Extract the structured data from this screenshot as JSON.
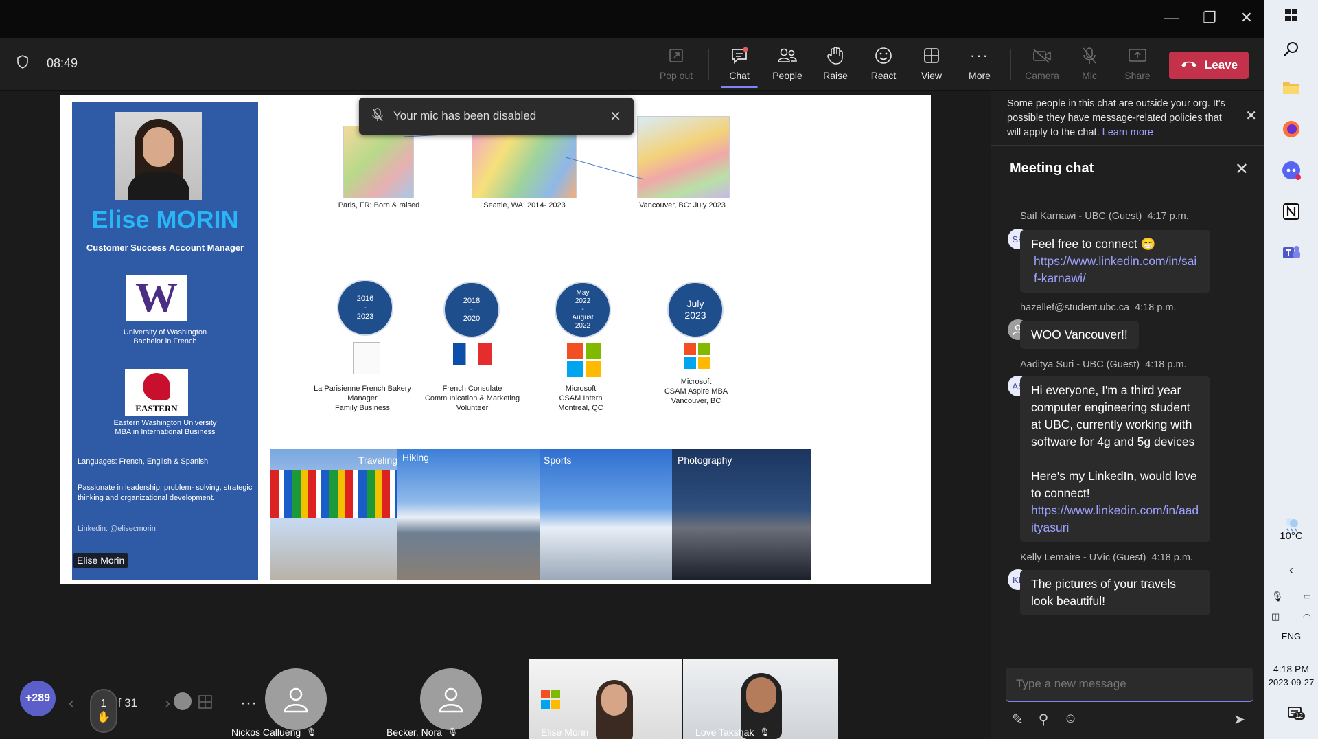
{
  "toolbar": {
    "time": "08:49",
    "pop_out": "Pop out",
    "chat": "Chat",
    "people": "People",
    "raise": "Raise",
    "react": "React",
    "view": "View",
    "more": "More",
    "camera": "Camera",
    "mic": "Mic",
    "share": "Share",
    "leave": "Leave"
  },
  "toast": {
    "text": "Your mic has been disabled"
  },
  "slide": {
    "name": "Elise  MORIN",
    "role": "Customer Success Account Manager",
    "uw_line1": "University of Washington",
    "uw_line2": "Bachelor in French",
    "ew_logo_text": "EASTERN",
    "ew_line1": "Eastern Washington University",
    "ew_line2": "MBA in International Business",
    "languages": "Languages: French, English & Spanish",
    "passion": "Passionate in leadership, problem- solving, strategic thinking and organizational development.",
    "linkedin": "Linkedin: @elisecmorin",
    "map1": "Paris, FR: Born & raised",
    "map2": "Seattle, WA: 2014- 2023",
    "map3": "Vancouver, BC: July 2023",
    "t1_a": "2016",
    "t1_b": "-",
    "t1_c": "2023",
    "t2_a": "2018",
    "t2_b": "-",
    "t2_c": "2020",
    "t3_a": "May",
    "t3_b": "2022",
    "t3_c": "-",
    "t3_d": "August",
    "t3_e": "2022",
    "t4_a": "July",
    "t4_b": "2023",
    "l1_a": "La Parisienne French Bakery",
    "l1_b": "Manager",
    "l1_c": "Family Business",
    "l2_a": "French Consulate",
    "l2_b": "Communication & Marketing",
    "l2_c": "Volunteer",
    "l3_a": "Microsoft",
    "l3_b": "CSAM Intern",
    "l3_c": "Montreal, QC",
    "l4_a": "Microsoft",
    "l4_b": "CSAM Aspire MBA",
    "l4_c": "Vancouver, BC",
    "h1": "Traveling",
    "h2": "Hiking",
    "h3": "Sports",
    "h4": "Photography",
    "presenter": "Elise Morin"
  },
  "slide_nav": {
    "position": "9 of 31"
  },
  "participants": {
    "count": "+289",
    "raised": "1",
    "p1": "Nickos Callueng",
    "p2": "Becker, Nora",
    "p3": "Elise Morin",
    "p4": "Love Takshak"
  },
  "chat": {
    "banner": "Some people in this chat are outside your org. It's possible they have message-related policies that will apply to the chat.",
    "banner_link": "Learn more",
    "title": "Meeting chat",
    "m1_author": "Saif Karnawi - UBC (Guest)",
    "m1_time": "4:17 p.m.",
    "m1_initials": "SK",
    "m1_text": "Feel free to connect 😁",
    "m1_link": "https://www.linkedin.com/in/saif-karnawi/",
    "m2_author": "hazellef@student.ubc.ca",
    "m2_time": "4:18 p.m.",
    "m2_text": "WOO Vancouver!!",
    "m3_author": "Aaditya Suri - UBC (Guest)",
    "m3_time": "4:18 p.m.",
    "m3_initials": "AS",
    "m3_text": "Hi everyone, I'm a third year computer engineering student at UBC, currently working with software for 4g and 5g devices",
    "m3_text2": "Here's my LinkedIn, would love to connect!",
    "m3_link": "https://www.linkedin.com/in/aadityasuri",
    "m4_author": "Kelly Lemaire - UVic (Guest)",
    "m4_time": "4:18 p.m.",
    "m4_initials": "KL",
    "m4_text": "The pictures of your travels look beautiful!",
    "placeholder": "Type a new message"
  },
  "taskbar": {
    "temp": "10°C",
    "lang": "ENG",
    "time": "4:18 PM",
    "date": "2023-09-27",
    "notifications": "12"
  }
}
